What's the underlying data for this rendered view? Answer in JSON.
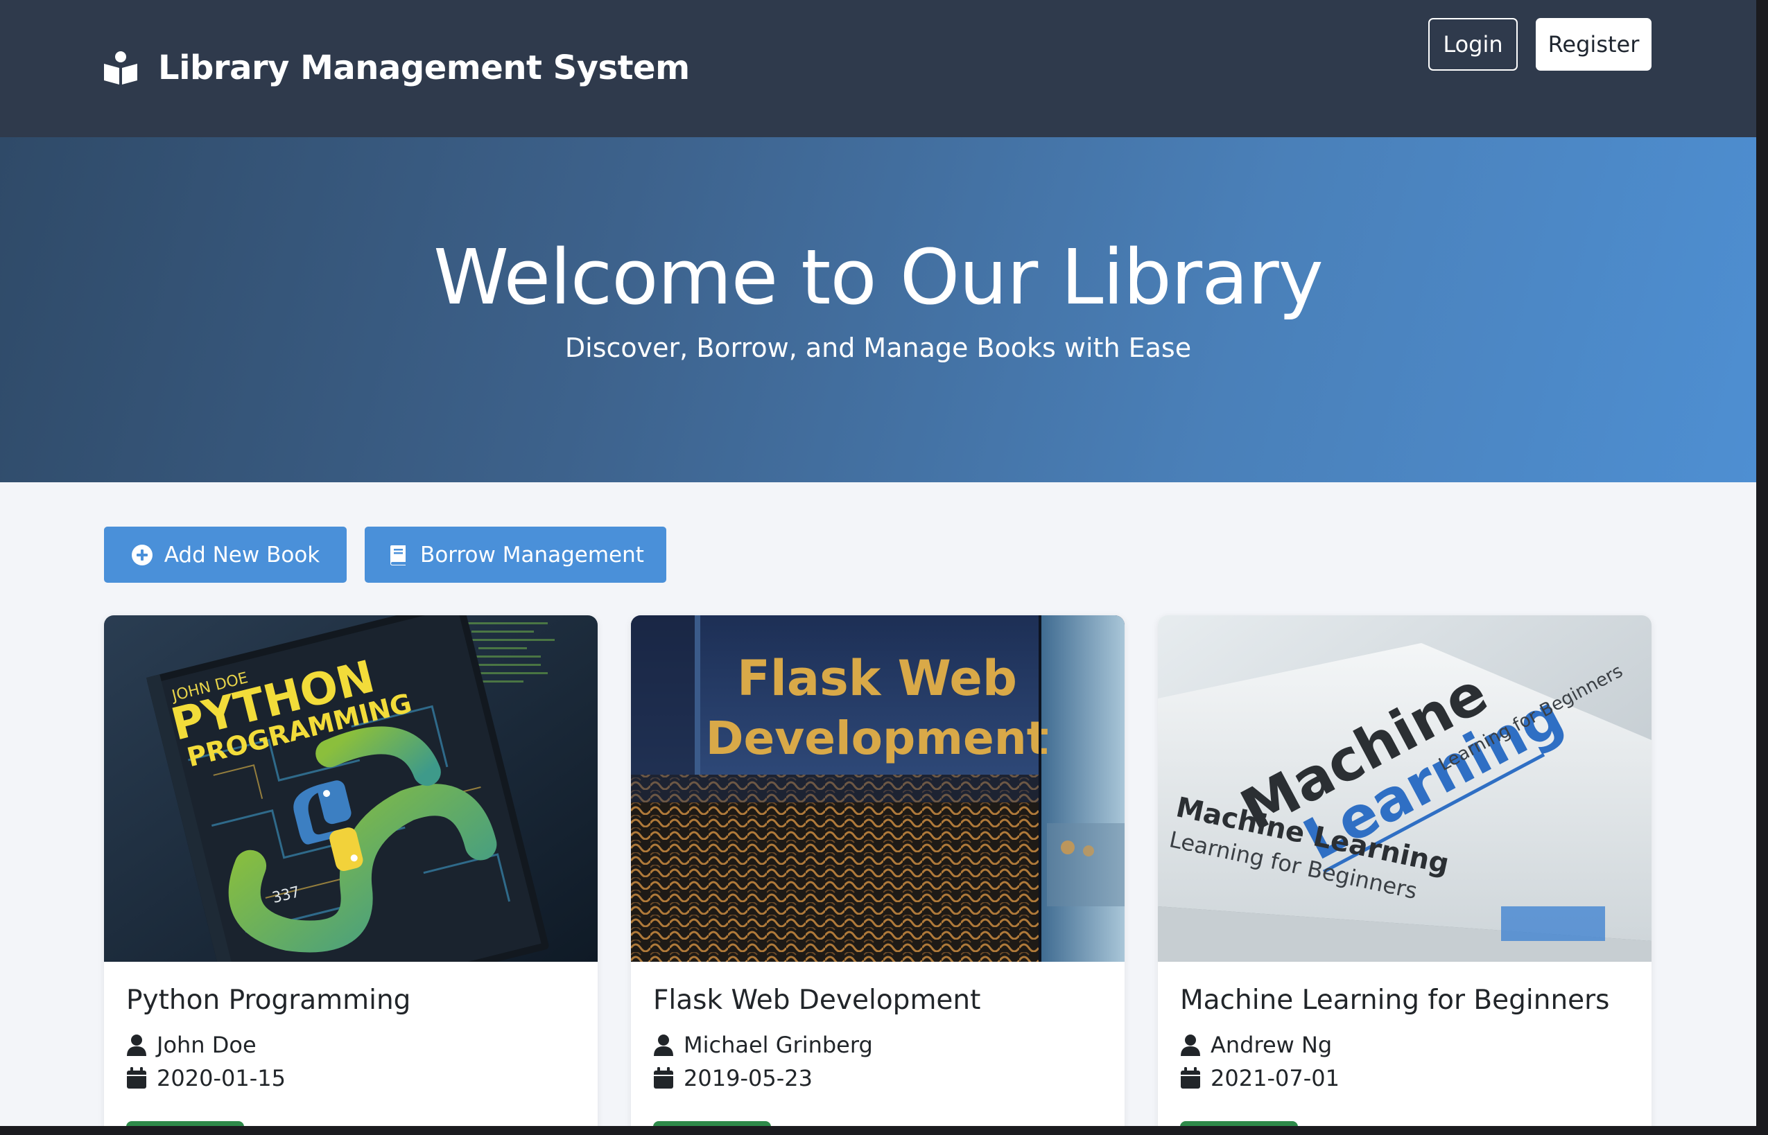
{
  "navbar": {
    "brand_icon": "book-reader-icon",
    "brand": "Library Management System",
    "login_label": "Login",
    "register_label": "Register"
  },
  "hero": {
    "title": "Welcome to Our Library",
    "subtitle": "Discover, Borrow, and Manage Books with Ease"
  },
  "actions": {
    "add_book": {
      "icon": "plus-circle-icon",
      "label": "Add New Book"
    },
    "borrow": {
      "icon": "book-icon",
      "label": "Borrow Management"
    }
  },
  "books": [
    {
      "title": "Python Programming",
      "author": "John Doe",
      "date": "2020-01-15",
      "cover_theme": "python-snake-cover"
    },
    {
      "title": "Flask Web Development",
      "author": "Michael Grinberg",
      "date": "2019-05-23",
      "cover_theme": "flask-gold-cover"
    },
    {
      "title": "Machine Learning for Beginners",
      "author": "Andrew Ng",
      "date": "2021-07-01",
      "cover_theme": "ml-white-book-cover"
    }
  ],
  "colors": {
    "navbar_bg": "#2f3a4c",
    "hero_gradient_start": "#2f4a68",
    "hero_gradient_end": "#4e8fd2",
    "action_button": "#4a90d9",
    "status_green": "#2e8a4a",
    "page_bg": "#f3f5f9"
  }
}
